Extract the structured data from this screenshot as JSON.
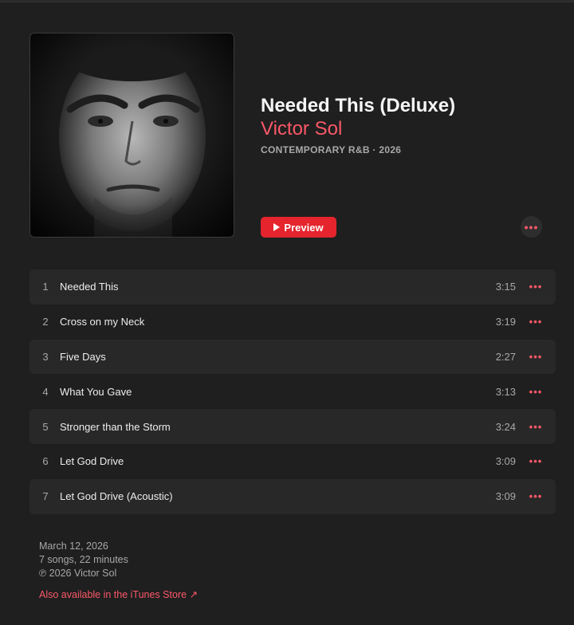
{
  "album": {
    "title": "Needed This (Deluxe)",
    "artist": "Victor Sol",
    "meta": "CONTEMPORARY R&B · 2026",
    "preview_label": "Preview",
    "more_label": "•••"
  },
  "tracks": [
    {
      "num": "1",
      "title": "Needed This",
      "duration": "3:15",
      "more": "•••"
    },
    {
      "num": "2",
      "title": "Cross on my Neck",
      "duration": "3:19",
      "more": "•••"
    },
    {
      "num": "3",
      "title": "Five Days",
      "duration": "2:27",
      "more": "•••"
    },
    {
      "num": "4",
      "title": "What You Gave",
      "duration": "3:13",
      "more": "•••"
    },
    {
      "num": "5",
      "title": "Stronger than the Storm",
      "duration": "3:24",
      "more": "•••"
    },
    {
      "num": "6",
      "title": "Let God Drive",
      "duration": "3:09",
      "more": "•••"
    },
    {
      "num": "7",
      "title": "Let God Drive (Acoustic)",
      "duration": "3:09",
      "more": "•••"
    }
  ],
  "footer": {
    "release_date": "March 12, 2026",
    "summary": "7 songs, 22 minutes",
    "copyright": "℗ 2026 Victor Sol",
    "itunes_link": "Also available in the iTunes Store ↗"
  },
  "colors": {
    "background": "#1f1f1f",
    "accent": "#fa5868",
    "preview_button": "#e5242d",
    "row_alt": "#282828"
  },
  "icons": {
    "preview": "play-icon",
    "more": "ellipsis-icon",
    "external": "arrow-up-right-icon"
  }
}
